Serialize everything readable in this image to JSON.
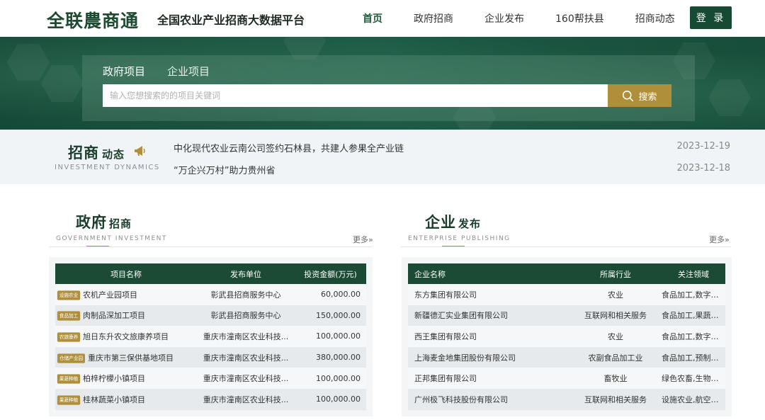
{
  "header": {
    "logo": "全联農商通",
    "platform_title": "全国农业产业招商大数据平台",
    "nav": [
      {
        "label": "首页",
        "active": true
      },
      {
        "label": "政府招商",
        "active": false
      },
      {
        "label": "企业发布",
        "active": false
      },
      {
        "label": "160帮扶县",
        "active": false
      },
      {
        "label": "招商动态",
        "active": false
      }
    ],
    "login_label": "登 录"
  },
  "search": {
    "tabs": [
      "政府项目",
      "企业项目"
    ],
    "active_tab": 0,
    "placeholder": "输入您想搜索的的项目关键词",
    "button_label": "搜索"
  },
  "dynamics": {
    "title_main": "招商",
    "title_sub": "动态",
    "title_en": "INVESTMENT DYNAMICS",
    "news": [
      {
        "title": "中化现代农业云南公司签约石林县，共建人参果全产业链",
        "date": "2023-12-19"
      },
      {
        "title": "“万企兴万村”助力贵州省",
        "date": "2023-12-18"
      }
    ]
  },
  "gov_section": {
    "title_main": "政府",
    "title_sub": "招商",
    "title_en": "GOVERNMENT INVESTMENT",
    "more_label": "更多",
    "columns": [
      "项目名称",
      "发布单位",
      "投资金额(万元)"
    ],
    "rows": [
      {
        "tag": "设施农业",
        "name": "农机产业园项目",
        "unit": "彰武县招商服务中心",
        "amount": "60,000.00"
      },
      {
        "tag": "食品加工",
        "name": "肉制品深加工项目",
        "unit": "彰武县招商服务中心",
        "amount": "150,000.00"
      },
      {
        "tag": "农旅康养",
        "name": "旭日东升农文旅康养项目",
        "unit": "重庆市潼南区农业科技...",
        "amount": "100,000.00"
      },
      {
        "tag": "仓储产业园",
        "name": "重庆市第三保供基地项目",
        "unit": "重庆市潼南区农业科技...",
        "amount": "380,000.00"
      },
      {
        "tag": "果蔬种植",
        "name": "柏梓柠檬小镇项目",
        "unit": "重庆市潼南区农业科技...",
        "amount": "100,000.00"
      },
      {
        "tag": "果蔬种植",
        "name": "桂林蔬菜小镇项目",
        "unit": "重庆市潼南区农业科技...",
        "amount": "100,000.00"
      }
    ]
  },
  "ent_section": {
    "title_main": "企业",
    "title_sub": "发布",
    "title_en": "ENTERPRISE PUBLISHING",
    "more_label": "更多",
    "columns": [
      "企业名称",
      "所属行业",
      "关注领域"
    ],
    "rows": [
      {
        "name": "东方集团有限公司",
        "industry": "农业",
        "focus": "食品加工,数字产..."
      },
      {
        "name": "新疆德汇实业集团有限公司",
        "industry": "互联网和相关服务",
        "focus": "食品加工,果蔬种植"
      },
      {
        "name": "西王集团有限公司",
        "industry": "农业",
        "focus": "食品加工,数字产..."
      },
      {
        "name": "上海麦金地集团股份有限公司",
        "industry": "农副食品加工业",
        "focus": "食品加工,预制菜,..."
      },
      {
        "name": "正邦集团有限公司",
        "industry": "畜牧业",
        "focus": "绿色农畜,生物工..."
      },
      {
        "name": "广州极飞科技股份有限公司",
        "industry": "互联网和相关服务",
        "focus": "设施农业,航空制..."
      }
    ]
  },
  "colors": {
    "brand_green": "#164a33",
    "accent_gold": "#b08f3a"
  }
}
